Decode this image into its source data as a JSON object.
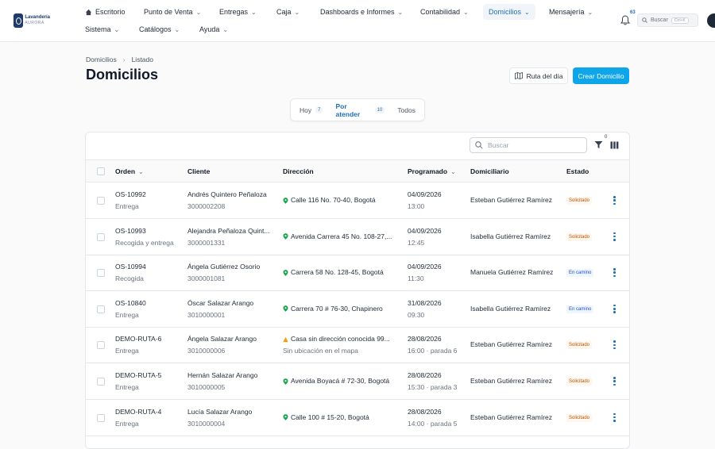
{
  "brand": {
    "name": "Lavandería",
    "tagline": "AURORA"
  },
  "nav": {
    "row1": [
      {
        "label": "Escritorio",
        "icon": "home-icon"
      },
      {
        "label": "Punto de Venta"
      },
      {
        "label": "Entregas"
      },
      {
        "label": "Caja"
      },
      {
        "label": "Dashboards e Informes"
      },
      {
        "label": "Contabilidad"
      },
      {
        "label": "Domicilios",
        "active": true
      },
      {
        "label": "Mensajería"
      }
    ],
    "row2": [
      {
        "label": "Sistema"
      },
      {
        "label": "Catálogos"
      },
      {
        "label": "Ayuda"
      }
    ],
    "notifications": "63",
    "search_label": "Buscar",
    "search_kbd": "Ctrl+K"
  },
  "breadcrumb": {
    "root": "Domicilios",
    "current": "Listado"
  },
  "page": {
    "title": "Domicilios",
    "route_button": "Ruta del día",
    "create_button": "Crear Domicilio"
  },
  "tabs": [
    {
      "label": "Hoy",
      "count": "7"
    },
    {
      "label": "Por atender",
      "count": "10",
      "active": true
    },
    {
      "label": "Todos"
    }
  ],
  "table": {
    "search_placeholder": "Buscar",
    "filter_count": "0",
    "columns": {
      "orden": "Orden",
      "cliente": "Cliente",
      "direccion": "Dirección",
      "programado": "Programado",
      "domiciliario": "Domiciliario",
      "estado": "Estado"
    },
    "rows": [
      {
        "orden": "OS-10992",
        "tipo": "Entrega",
        "cliente": "Andrés Quintero Peñaloza",
        "telefono": "3000002208",
        "direccion": "Calle 116 No. 70-40, Bogotá",
        "fecha": "04/09/2026",
        "hora": "13:00",
        "domiciliario": "Esteban Gutiérrez Ramírez",
        "estado": "Solicitado"
      },
      {
        "orden": "OS-10993",
        "tipo": "Recogida y entrega",
        "cliente": "Alejandra Peñaloza Quint...",
        "telefono": "3000001331",
        "direccion": "Avenida Carrera 45 No. 108-27,...",
        "fecha": "04/09/2026",
        "hora": "12:45",
        "domiciliario": "Isabella Gutiérrez Ramírez",
        "estado": "Solicitado"
      },
      {
        "orden": "OS-10994",
        "tipo": "Recogida",
        "cliente": "Ángela Gutiérrez Osorio",
        "telefono": "3000001081",
        "direccion": "Carrera 58 No. 128-45, Bogotá",
        "fecha": "04/09/2026",
        "hora": "11:30",
        "domiciliario": "Manuela Gutiérrez Ramírez",
        "estado": "En camino"
      },
      {
        "orden": "OS-10840",
        "tipo": "Entrega",
        "cliente": "Óscar Salazar Arango",
        "telefono": "3010000001",
        "direccion": "Carrera 70 # 76-30, Chapinero",
        "fecha": "31/08/2026",
        "hora": "09:30",
        "domiciliario": "Isabella Gutiérrez Ramírez",
        "estado": "En camino"
      },
      {
        "orden": "DEMO-RUTA-6",
        "tipo": "Entrega",
        "cliente": "Ángela Salazar Arango",
        "telefono": "3010000006",
        "direccion": "Casa sin dirección conocida 99...",
        "direccion_nota": "Sin ubicación en el mapa",
        "warning": true,
        "fecha": "28/08/2026",
        "hora": "16:00 · parada 6",
        "domiciliario": "Esteban Gutiérrez Ramírez",
        "estado": "Solicitado"
      },
      {
        "orden": "DEMO-RUTA-5",
        "tipo": "Entrega",
        "cliente": "Hernán Salazar Arango",
        "telefono": "3010000005",
        "direccion": "Avenida Boyacá # 72-30, Bogotá",
        "fecha": "28/08/2026",
        "hora": "15:30 · parada 3",
        "domiciliario": "Esteban Gutiérrez Ramírez",
        "estado": "Solicitado"
      },
      {
        "orden": "DEMO-RUTA-4",
        "tipo": "Entrega",
        "cliente": "Lucía Salazar Arango",
        "telefono": "3010000004",
        "direccion": "Calle 100 # 15-20, Bogotá",
        "fecha": "28/08/2026",
        "hora": "14:00 · parada 5",
        "domiciliario": "Esteban Gutiérrez Ramírez",
        "estado": "Solicitado"
      }
    ]
  },
  "colors": {
    "accent": "#1d6fb8",
    "primary_button": "#0ea5e9",
    "pin": "#16a34a",
    "warning": "#f59e0b",
    "solicitado": "#b45309",
    "en_camino": "#1d4ed8"
  }
}
